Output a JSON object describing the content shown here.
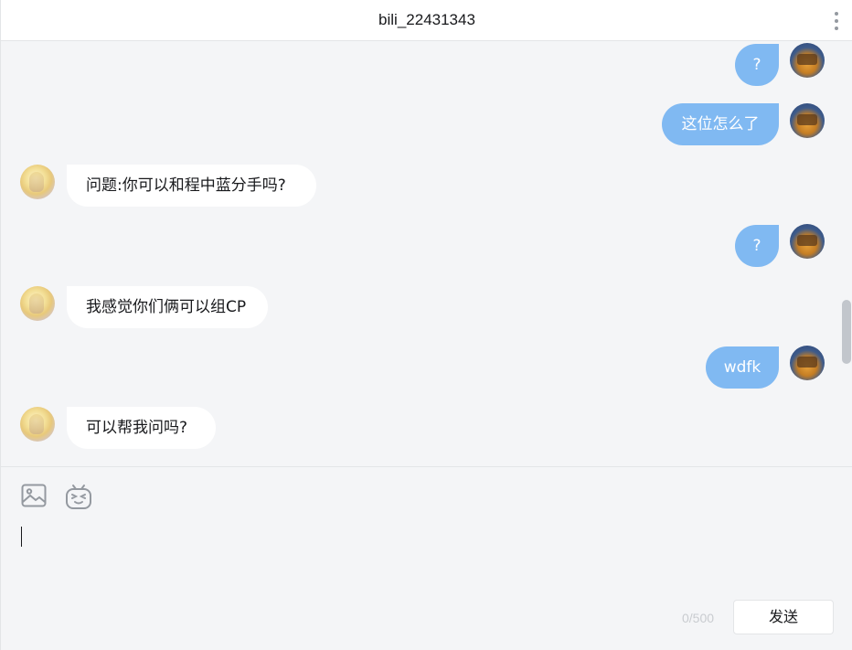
{
  "header": {
    "title": "bili_22431343"
  },
  "messages": [
    {
      "from": "me",
      "text": "?"
    },
    {
      "from": "me",
      "text": "这位怎么了"
    },
    {
      "from": "other",
      "text": "问题:你可以和程中蓝分手吗?"
    },
    {
      "from": "me",
      "text": "?"
    },
    {
      "from": "other",
      "text": "我感觉你们俩可以组CP"
    },
    {
      "from": "me",
      "text": "wdfk"
    },
    {
      "from": "other",
      "text": "可以帮我问吗?"
    }
  ],
  "composer": {
    "input_value": "",
    "counter": "0/500",
    "send_label": "发送"
  },
  "colors": {
    "my_bubble": "#80b9f2",
    "other_bubble": "#ffffff",
    "background": "#f4f5f7"
  },
  "icons": {
    "image": "image-icon",
    "emoji": "emoji-icon",
    "more": "more-vertical-icon"
  }
}
